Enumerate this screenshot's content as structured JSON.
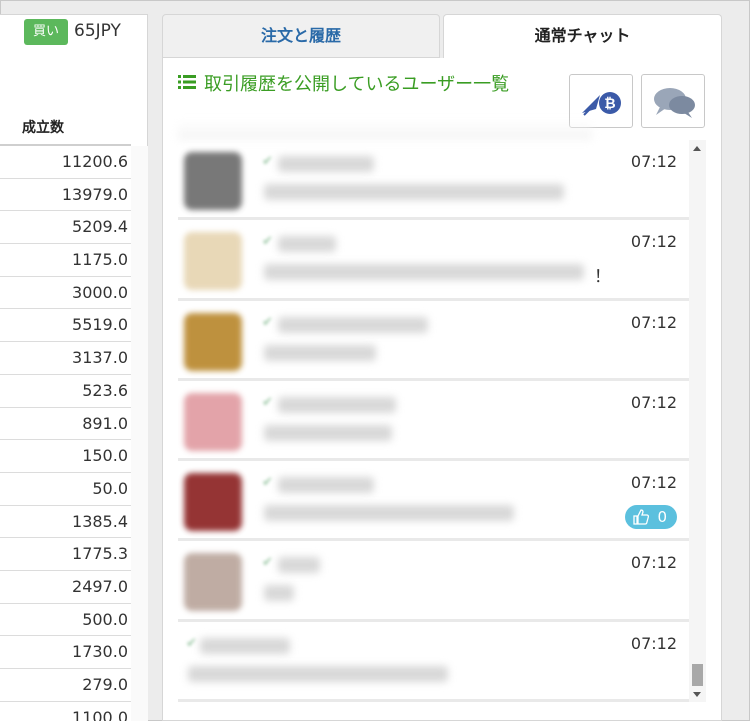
{
  "buy_panel": {
    "badge_label": "買い",
    "price_text": "65JPY"
  },
  "trade_table": {
    "header": "成立数",
    "rows": [
      "11200.6",
      "13979.0",
      "5209.4",
      "1175.0",
      "3000.0",
      "5519.0",
      "3137.0",
      "523.6",
      "891.0",
      "150.0",
      "50.0",
      "1385.4",
      "1775.3",
      "2497.0",
      "500.0",
      "1730.0",
      "279.0",
      "1100.0"
    ]
  },
  "tabs": [
    {
      "label": "注文と履歴",
      "active": false
    },
    {
      "label": "通常チャット",
      "active": true
    }
  ],
  "chat_panel": {
    "title": "取引履歴を公開しているユーザー一覧",
    "title_color": "#3a9d23",
    "bitcoin_button_icon": "bitcoin-rocket-icon",
    "chat_button_icon": "chat-bubbles-icon"
  },
  "chat_items": [
    {
      "time": "07:12",
      "avatar_color": "#6a6a6a",
      "trailing_text": "",
      "likes": null
    },
    {
      "time": "07:12",
      "avatar_color": "#e6d4b0",
      "trailing_text": "！",
      "likes": null
    },
    {
      "time": "07:12",
      "avatar_color": "#b8862a",
      "trailing_text": "",
      "likes": null
    },
    {
      "time": "07:12",
      "avatar_color": "#e09aa0",
      "trailing_text": "",
      "likes": null
    },
    {
      "time": "07:12",
      "avatar_color": "#8a1f1f",
      "trailing_text": "",
      "likes": "0"
    },
    {
      "time": "07:12",
      "avatar_color": "#b9a49a",
      "trailing_text": "",
      "likes": null
    },
    {
      "time": "07:12",
      "avatar_color": "#ffffff",
      "trailing_text": "",
      "likes": null
    }
  ],
  "colors": {
    "buy_green": "#5cb85c",
    "tab_blue": "#2a6aa8",
    "like_blue": "#5bc0de"
  }
}
